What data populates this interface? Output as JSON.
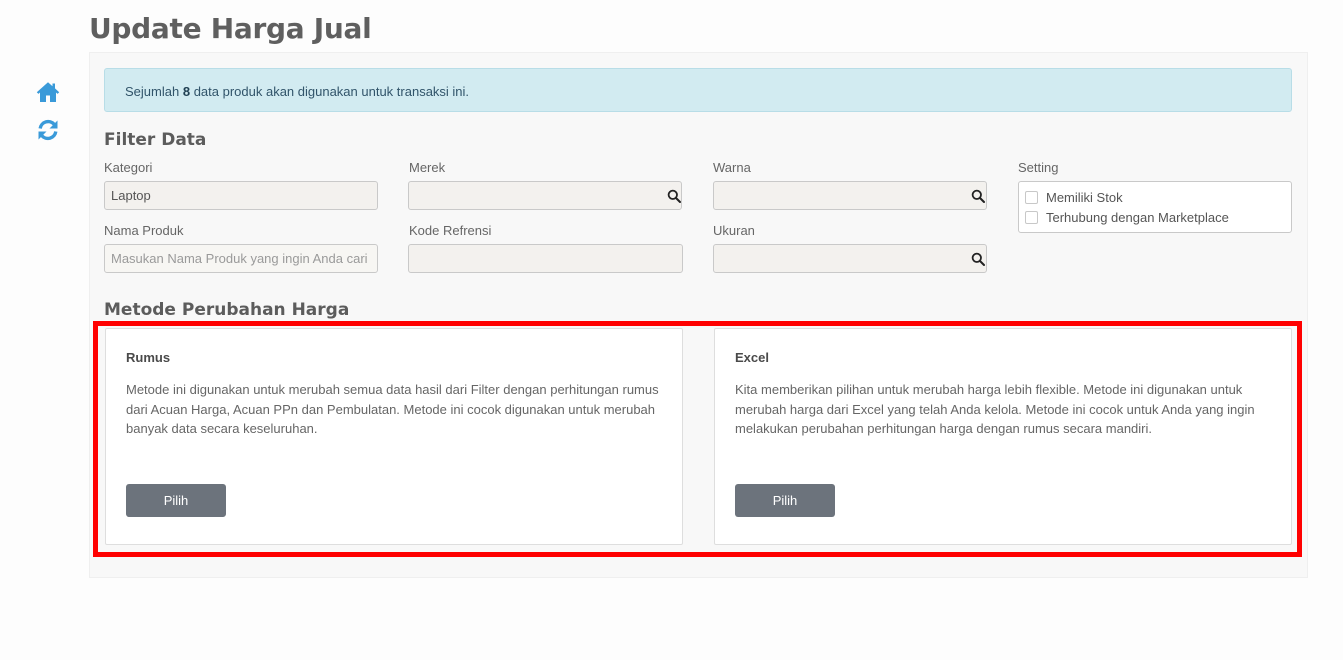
{
  "page": {
    "title": "Update Harga Jual"
  },
  "sidebar": {
    "home_icon": "home-icon",
    "refresh_icon": "refresh-icon"
  },
  "alert": {
    "prefix": "Sejumlah",
    "count": "8",
    "suffix": "data produk akan digunakan untuk transaksi ini."
  },
  "filter": {
    "title": "Filter Data",
    "kategori": {
      "label": "Kategori",
      "value": "Laptop"
    },
    "merek": {
      "label": "Merek",
      "value": ""
    },
    "warna": {
      "label": "Warna",
      "value": ""
    },
    "setting": {
      "label": "Setting",
      "options": [
        {
          "label": "Memiliki Stok",
          "checked": false
        },
        {
          "label": "Terhubung dengan Marketplace",
          "checked": false
        }
      ]
    },
    "nama_produk": {
      "label": "Nama Produk",
      "value": "",
      "placeholder": "Masukan Nama Produk yang ingin Anda cari"
    },
    "kode_refrensi": {
      "label": "Kode Refrensi",
      "value": ""
    },
    "ukuran": {
      "label": "Ukuran",
      "value": ""
    }
  },
  "metode": {
    "title": "Metode Perubahan Harga",
    "cards": [
      {
        "title": "Rumus",
        "description": "Metode ini digunakan untuk merubah semua data hasil dari Filter dengan perhitungan rumus dari Acuan Harga, Acuan PPn dan Pembulatan. Metode ini cocok digunakan untuk merubah banyak data secara keseluruhan.",
        "button": "Pilih"
      },
      {
        "title": "Excel",
        "description": "Kita memberikan pilihan untuk merubah harga lebih flexible. Metode ini digunakan untuk merubah harga dari Excel yang telah Anda kelola. Metode ini cocok untuk Anda yang ingin melakukan perubahan perhitungan harga dengan rumus secara mandiri.",
        "button": "Pilih"
      }
    ]
  },
  "colors": {
    "accent": "#3a9ad9",
    "alert_bg": "#d2ebf1",
    "button": "#6c737c",
    "highlight": "#ff0000"
  }
}
